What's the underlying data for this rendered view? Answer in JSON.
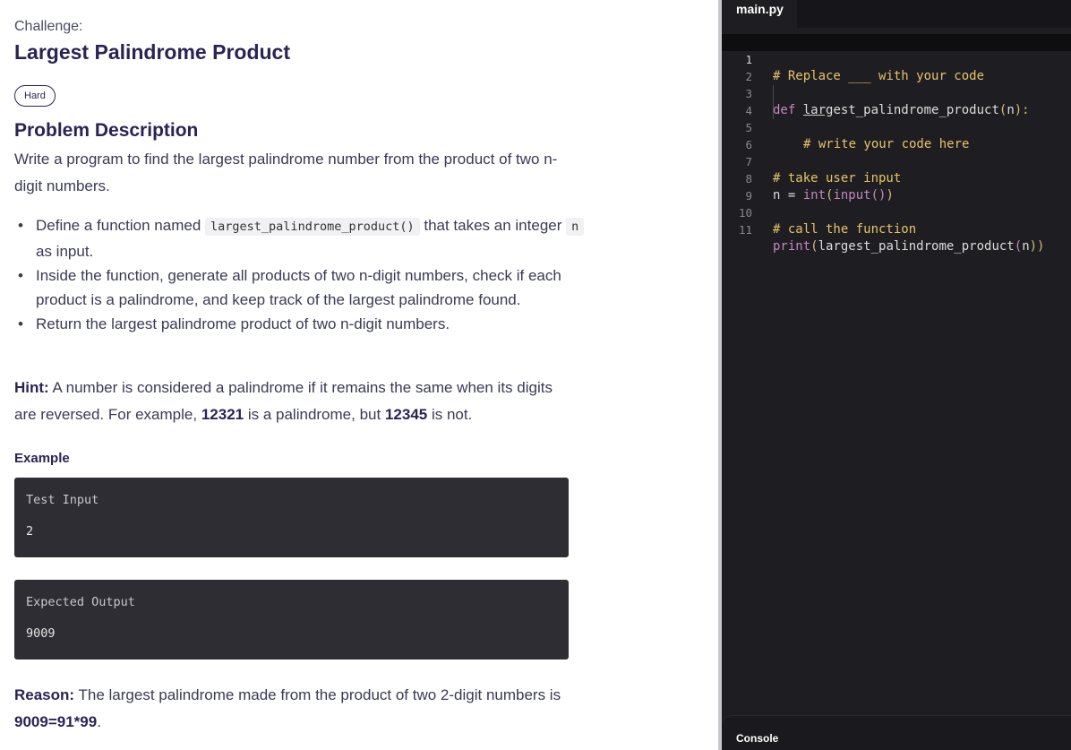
{
  "challenge": {
    "label": "Challenge:",
    "title": "Largest Palindrome Product",
    "difficulty": "Hard"
  },
  "problem": {
    "heading": "Problem Description",
    "description": "Write a program to find the largest palindrome number from the product of two n-digit numbers.",
    "bullets": {
      "b1_pre": "Define a function named",
      "b1_code": "largest_palindrome_product()",
      "b1_post": "that takes an integer",
      "b1_code2": "n",
      "b1_end": "as input.",
      "b2": "Inside the function, generate all products of two n-digit numbers, check if each product is a palindrome, and keep track of the largest palindrome found.",
      "b3": "Return the largest palindrome product of two n-digit numbers."
    },
    "hint": {
      "label": "Hint:",
      "text_pre": "A number is considered a palindrome if it remains the same when its digits are reversed. For example,",
      "example1": "12321",
      "text_mid": "is a palindrome, but",
      "example2": "12345",
      "text_post": "is not."
    }
  },
  "example": {
    "heading": "Example",
    "test_input_label": "Test Input",
    "test_input_value": "2",
    "expected_output_label": "Expected Output",
    "expected_output_value": "9009"
  },
  "reason": {
    "label": "Reason:",
    "text": "The largest palindrome made from the product of two 2-digit numbers is",
    "equation": "9009=91*99",
    "end": "."
  },
  "editor": {
    "file_tab": "main.py",
    "lines": {
      "n1": "1",
      "n2": "2",
      "n3": "3",
      "n4": "4",
      "n5": "5",
      "n6": "6",
      "n7": "7",
      "n8": "8",
      "n9": "9",
      "n10": "10",
      "n11": "11",
      "l1_a": "# Replace ",
      "l1_blank": "___",
      "l1_b": " with your code",
      "l3_def": "def",
      "l3_fn": " largest_palindrome_product",
      "l3_open": "(",
      "l3_arg": "n",
      "l3_close": "):",
      "l4": "# write your code here",
      "l7": "# take user input",
      "l8_a": "n = ",
      "l8_int": "int",
      "l8_p1": "(",
      "l8_input": "input",
      "l8_p2": "()",
      "l8_p3": ")",
      "l10": "# call the function",
      "l11_print": "print",
      "l11_p1": "(",
      "l11_fn": "largest_palindrome_product",
      "l11_p2": "(",
      "l11_arg": "n",
      "l11_p3": "))"
    },
    "console_label": "Console"
  },
  "colors": {
    "title": "#2a2356",
    "editor_bg": "#1e1e22",
    "comment": "#e8c267",
    "keyword": "#c586c0"
  }
}
